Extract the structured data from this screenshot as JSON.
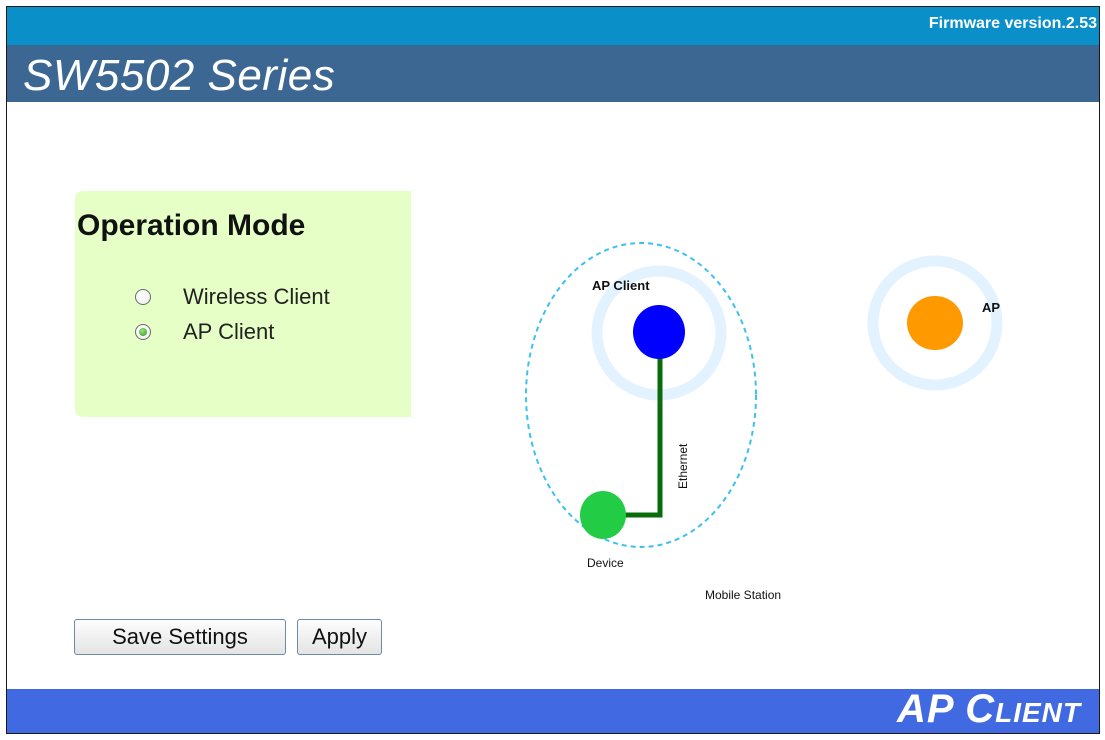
{
  "header": {
    "firmware": "Firmware version.2.53",
    "brand": "SW5502 Series"
  },
  "mode_panel": {
    "title": "Operation Mode",
    "options": [
      {
        "label": "Wireless Client",
        "checked": false
      },
      {
        "label": "AP Client",
        "checked": true
      }
    ]
  },
  "diagram": {
    "ap_client_label": "AP Client",
    "ap_label": "AP",
    "ethernet_label": "Ethernet",
    "device_label": "Device",
    "mobile_station_label": "Mobile Station",
    "colors": {
      "ap_client_node": "#0000ff",
      "ap_node": "#ff9900",
      "device_node": "#22cc44",
      "ethernet_line": "#0a6b0a",
      "halo": "#e3f2ff",
      "dashed_ellipse": "#3ec0ee"
    }
  },
  "buttons": {
    "save_label": "Save Settings",
    "apply_label": "Apply"
  },
  "footer": {
    "page_title": "AP Client"
  }
}
